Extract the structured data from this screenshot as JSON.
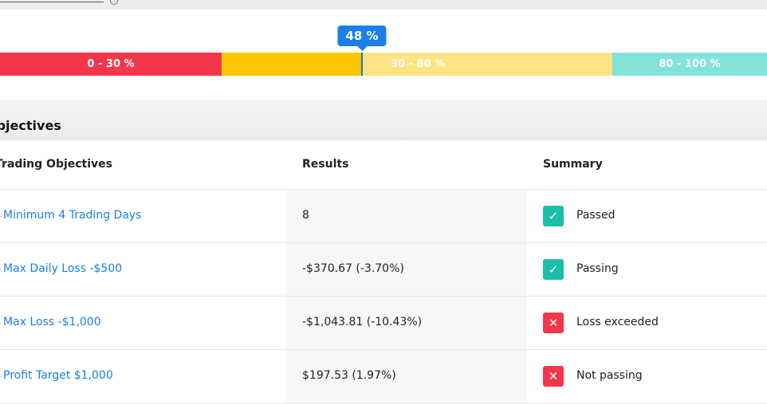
{
  "progress": {
    "value_percent": 48,
    "tooltip_label": "48 %",
    "segments": [
      {
        "label": "0 - 30 %",
        "color": "#f4364c"
      },
      {
        "label": "",
        "color": "#fec600"
      },
      {
        "label": "30 - 80 %",
        "color": "#fee484"
      },
      {
        "label": "80 - 100 %",
        "color": "#83e3d9"
      }
    ]
  },
  "objectives": {
    "section_title": "Objectives",
    "columns": {
      "objective": "Trading Objectives",
      "results": "Results",
      "summary": "Summary"
    },
    "rows": [
      {
        "objective": "Minimum 4 Trading Days",
        "result": "8",
        "summary": "Passed",
        "status": "pass",
        "icon": "check-icon"
      },
      {
        "objective": "Max Daily Loss -$500",
        "result": "-$370.67 (-3.70%)",
        "summary": "Passing",
        "status": "pass",
        "icon": "check-icon"
      },
      {
        "objective": "Max Loss -$1,000",
        "result": "-$1,043.81 (-10.43%)",
        "summary": "Loss exceeded",
        "status": "fail",
        "icon": "cross-icon"
      },
      {
        "objective": "Profit Target $1,000",
        "result": "$197.53 (1.97%)",
        "summary": "Not passing",
        "status": "fail",
        "icon": "cross-icon"
      }
    ]
  },
  "colors": {
    "accent_blue": "#1a7fe8",
    "pass_green": "#19bfa8",
    "fail_red": "#f4364c"
  }
}
